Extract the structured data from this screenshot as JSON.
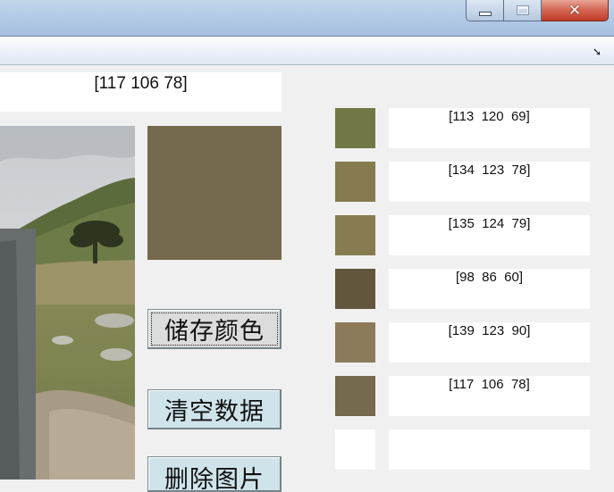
{
  "window": {
    "buttons": {
      "minimize": "minimize",
      "maximize": "maximize",
      "close": "close"
    }
  },
  "current": {
    "rgb_text": "[117  106   78]",
    "color": "#756a4e"
  },
  "buttons": {
    "save": "储存颜色",
    "clear": "清空数据",
    "delete": "删除图片"
  },
  "saved_colors": [
    {
      "rgb_text": "[113  120  69]",
      "color": "#717845"
    },
    {
      "rgb_text": "[134  123  78]",
      "color": "#867b4e"
    },
    {
      "rgb_text": "[135  124  79]",
      "color": "#877c4f"
    },
    {
      "rgb_text": "[98  86  60]",
      "color": "#62563c"
    },
    {
      "rgb_text": "[139  123  90]",
      "color": "#8b7b5a"
    },
    {
      "rgb_text": "[117  106  78]",
      "color": "#756a4e"
    },
    {
      "rgb_text": "",
      "color": "#ffffff"
    }
  ]
}
